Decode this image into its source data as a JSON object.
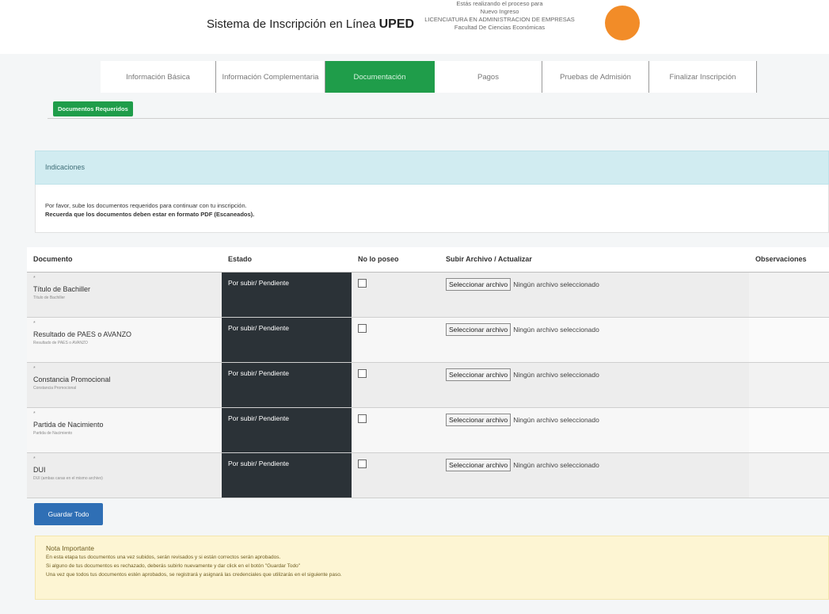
{
  "header": {
    "title_prefix": "Sistema de Inscripción en Línea ",
    "title_brand": "UPED",
    "info_lines": [
      "Estás realizando el proceso para",
      "Nuevo Ingreso",
      "LICENCIATURA EN ADMINISTRACION DE EMPRESAS",
      "Facultad De Ciencias Económicas"
    ],
    "avatar_color": "#f28c28"
  },
  "tabs": [
    {
      "label": "Información Básica"
    },
    {
      "label": "Información Complementaria"
    },
    {
      "label": "Documentación"
    },
    {
      "label": "Pagos"
    },
    {
      "label": "Pruebas de Admisión"
    },
    {
      "label": "Finalizar Inscripción"
    }
  ],
  "active_tab_color": "#1f9d4a",
  "subtab": {
    "label": "Documentos Requeridos"
  },
  "indications": {
    "title": "Indicaciones",
    "line1": "Por favor, sube los documentos requeridos para continuar con tu inscripción.",
    "line2": "Recuerda que los documentos deben estar en formato PDF (Escaneados)."
  },
  "table": {
    "headers": {
      "document": "Documento",
      "status": "Estado",
      "none": "No lo poseo",
      "upload": "Subir Archivo / Actualizar",
      "observations": "Observaciones"
    },
    "rows": [
      {
        "required_mark": "*",
        "name": "Título de Bachiller",
        "sub": "Título de Bachiller",
        "status": "Por subir/ Pendiente",
        "file_button": "Seleccionar archivo",
        "file_status": "Ningún archivo seleccionado"
      },
      {
        "required_mark": "*",
        "name": "Resultado de PAES o AVANZO",
        "sub": "Resultado de PAES o AVANZO",
        "status": "Por subir/ Pendiente",
        "file_button": "Seleccionar archivo",
        "file_status": "Ningún archivo seleccionado"
      },
      {
        "required_mark": "*",
        "name": "Constancia Promocional",
        "sub": "Constancia Promocional",
        "status": "Por subir/ Pendiente",
        "file_button": "Seleccionar archivo",
        "file_status": "Ningún archivo seleccionado"
      },
      {
        "required_mark": "*",
        "name": "Partida de Nacimiento",
        "sub": "Partida de Nacimiento",
        "status": "Por subir/ Pendiente",
        "file_button": "Seleccionar archivo",
        "file_status": "Ningún archivo seleccionado"
      },
      {
        "required_mark": "*",
        "name": "DUI",
        "sub": "DUI (ambas caras en el mismo archivo)",
        "status": "Por subir/ Pendiente",
        "file_button": "Seleccionar archivo",
        "file_status": "Ningún archivo seleccionado"
      }
    ]
  },
  "save_button": {
    "label": "Guardar Todo"
  },
  "note": {
    "title": "Nota Importante",
    "line1": "En esta etapa tus documentos una vez subidos, serán revisados y si están correctos serán aprobados.",
    "line2": "Si alguno de tus documentos es rechazado, deberás subirlo nuevamente y dar click en el botón \"Guardar Todo\"",
    "line3": "Una vez que todos tus documentos estén aprobados, se registrará y asignará las credenciales que utilizarás en el siguiente paso."
  }
}
